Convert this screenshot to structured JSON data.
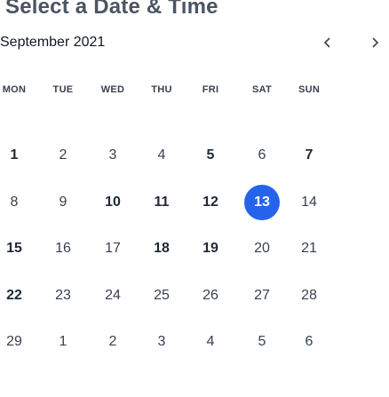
{
  "page": {
    "title": "Select a Date & Time"
  },
  "calendar": {
    "month_label": "September 2021",
    "prev_icon": "chevron-left-icon",
    "next_icon": "chevron-right-icon",
    "weekdays": [
      "MON",
      "TUE",
      "WED",
      "THU",
      "FRI",
      "SAT",
      "SUN"
    ],
    "weeks": [
      [
        {
          "d": "1",
          "s": "bold"
        },
        {
          "d": "2",
          "s": "muted"
        },
        {
          "d": "3",
          "s": "muted"
        },
        {
          "d": "4",
          "s": "muted"
        },
        {
          "d": "5",
          "s": "bold"
        },
        {
          "d": "6",
          "s": "muted"
        },
        {
          "d": "7",
          "s": "bold"
        }
      ],
      [
        {
          "d": "8",
          "s": "muted"
        },
        {
          "d": "9",
          "s": "muted"
        },
        {
          "d": "10",
          "s": "bold"
        },
        {
          "d": "11",
          "s": "bold"
        },
        {
          "d": "12",
          "s": "bold"
        },
        {
          "d": "13",
          "s": "selected"
        },
        {
          "d": "14",
          "s": "muted"
        }
      ],
      [
        {
          "d": "15",
          "s": "bold"
        },
        {
          "d": "16",
          "s": "muted"
        },
        {
          "d": "17",
          "s": "muted"
        },
        {
          "d": "18",
          "s": "bold"
        },
        {
          "d": "19",
          "s": "bold"
        },
        {
          "d": "20",
          "s": "muted"
        },
        {
          "d": "21",
          "s": "muted"
        }
      ],
      [
        {
          "d": "22",
          "s": "bold"
        },
        {
          "d": "23",
          "s": "muted"
        },
        {
          "d": "24",
          "s": "muted"
        },
        {
          "d": "25",
          "s": "muted"
        },
        {
          "d": "26",
          "s": "muted"
        },
        {
          "d": "27",
          "s": "muted"
        },
        {
          "d": "28",
          "s": "muted"
        }
      ],
      [
        {
          "d": "29",
          "s": "muted"
        },
        {
          "d": "1",
          "s": "muted"
        },
        {
          "d": "2",
          "s": "muted"
        },
        {
          "d": "3",
          "s": "muted"
        },
        {
          "d": "4",
          "s": "muted"
        },
        {
          "d": "5",
          "s": "muted"
        },
        {
          "d": "6",
          "s": "muted"
        }
      ]
    ],
    "colors": {
      "selected": "#2563eb",
      "text": "#1f2937"
    }
  }
}
